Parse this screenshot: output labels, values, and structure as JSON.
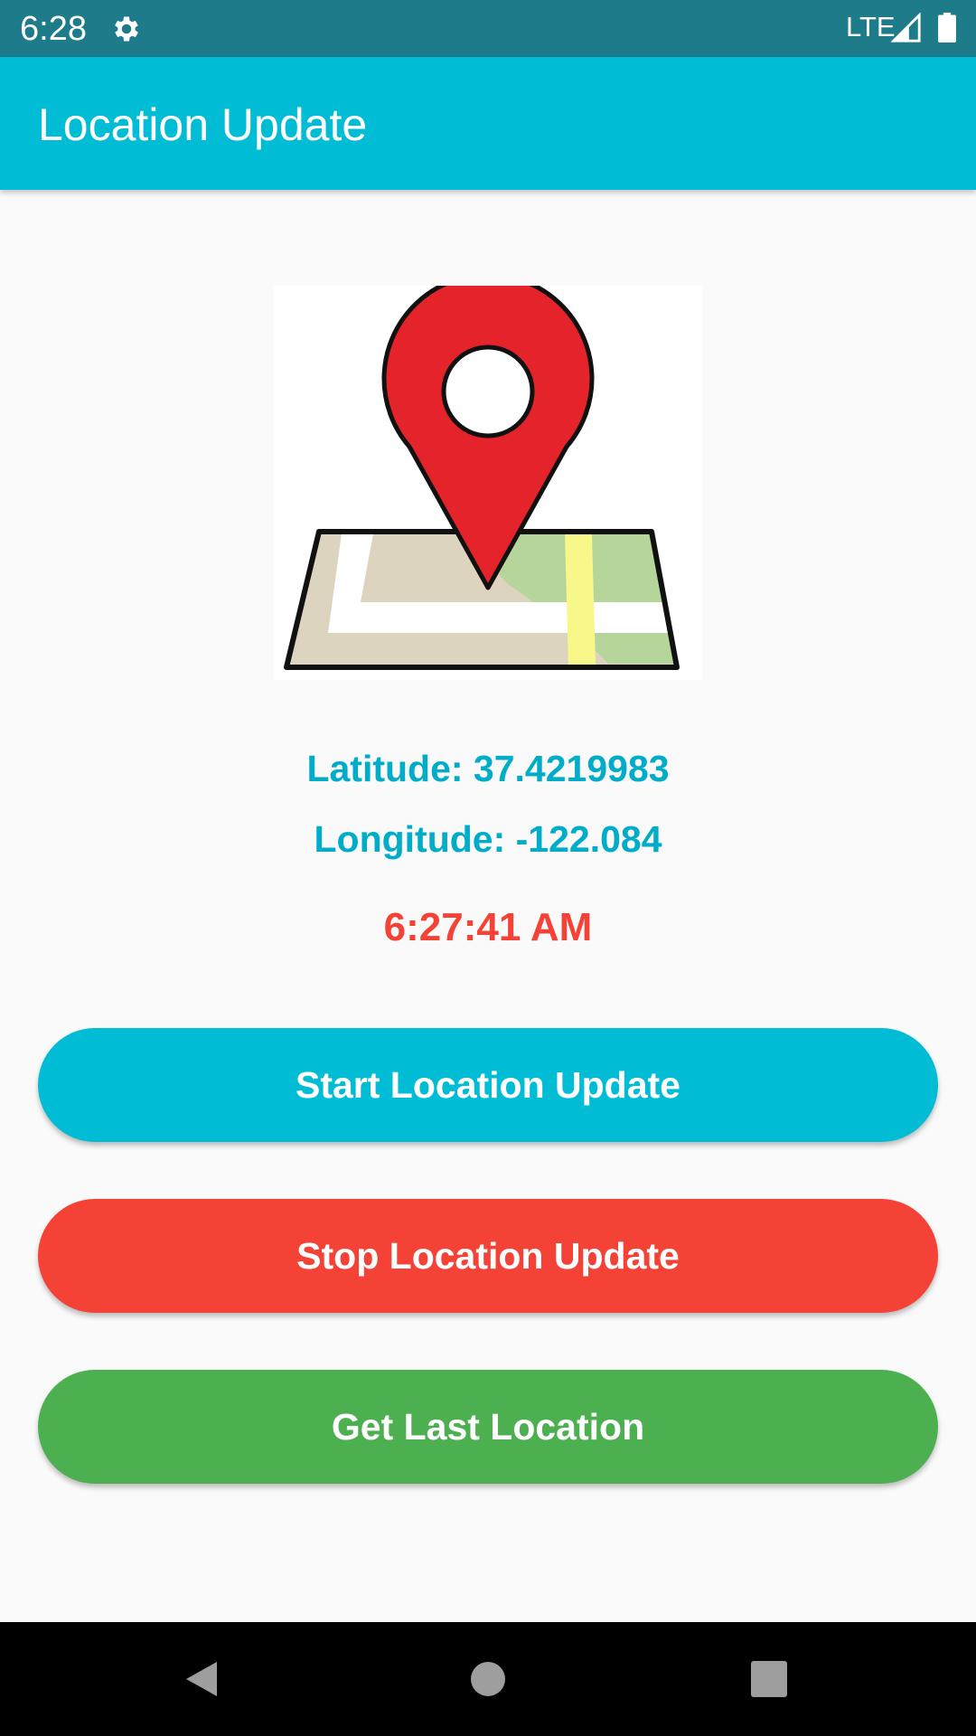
{
  "status_bar": {
    "time": "6:28",
    "network": "LTE",
    "icons": [
      "gear-icon",
      "signal-icon",
      "battery-icon"
    ],
    "background": "#1e7b8a"
  },
  "app_bar": {
    "title": "Location Update",
    "background": "#00bcd4"
  },
  "main": {
    "image_icon": "map-location-pin-icon",
    "latitude_text": "Latitude: 37.4219983",
    "longitude_text": "Longitude: -122.084",
    "last_update_time": "6:27:41 AM",
    "text_colors": {
      "coordinates": "#00acc8",
      "time": "#f44336"
    }
  },
  "buttons": {
    "start_label": "Start Location Update",
    "stop_label": "Stop Location Update",
    "last_label": "Get Last Location",
    "colors": {
      "start": "#00bcd4",
      "stop": "#f44336",
      "last": "#4caf50"
    }
  },
  "nav_bar": {
    "icons": [
      "back-icon",
      "home-icon",
      "recent-apps-icon"
    ]
  }
}
